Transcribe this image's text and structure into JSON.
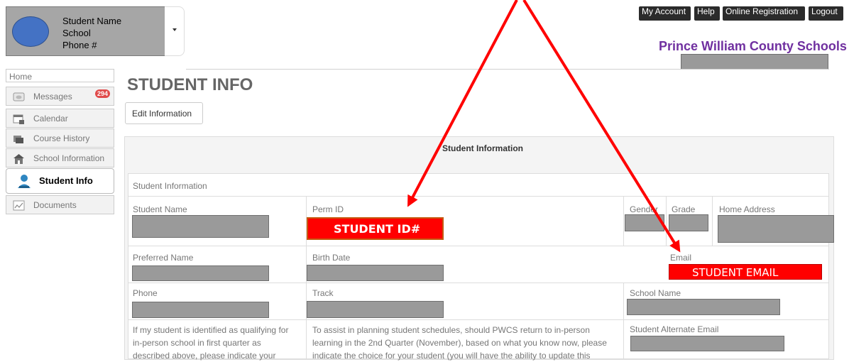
{
  "student_card": {
    "line1": "Student Name",
    "line2": "School",
    "line3": "Phone #"
  },
  "header": {
    "buttons": [
      "My Account",
      "Help",
      "Online Registration",
      "Logout"
    ],
    "district": "Prince William County Schools"
  },
  "sidebar": {
    "home": "Home",
    "items": [
      {
        "label": "Messages",
        "icon": "messages-icon",
        "badge": "294"
      },
      {
        "label": "Calendar",
        "icon": "calendar-icon"
      },
      {
        "label": "Course History",
        "icon": "course-history-icon"
      },
      {
        "label": "School Information",
        "icon": "school-icon"
      },
      {
        "label": "Student Info",
        "icon": "student-icon",
        "active": true
      },
      {
        "label": "Documents",
        "icon": "documents-icon"
      }
    ]
  },
  "main": {
    "title": "STUDENT INFO",
    "edit_button": "Edit Information",
    "panel_title": "Student Information",
    "section_title": "Student Information",
    "fields": {
      "student_name": "Student Name",
      "perm_id": "Perm ID",
      "gender": "Gender",
      "grade": "Grade",
      "home_address": "Home Address",
      "preferred_name": "Preferred Name",
      "birth_date": "Birth Date",
      "email": "Email",
      "phone": "Phone",
      "track": "Track",
      "school_name": "School Name",
      "alternate_email": "Student Alternate Email"
    },
    "annotations": {
      "student_id": "STUDENT ID#",
      "student_email": "STUDENT EMAIL"
    },
    "para_left": [
      "If my student is identified as qualifying for",
      "in-person school in first quarter as",
      "described above, please indicate your"
    ],
    "para_mid": [
      "To assist in planning student schedules, should PWCS return to in-person",
      "learning in the 2nd Quarter (November), based on what you know now, please",
      "indicate the choice for your student (you will have the ability to update this"
    ]
  },
  "colors": {
    "highlight": "#ff0000",
    "district": "#7030a0",
    "avatar": "#4472c4"
  }
}
